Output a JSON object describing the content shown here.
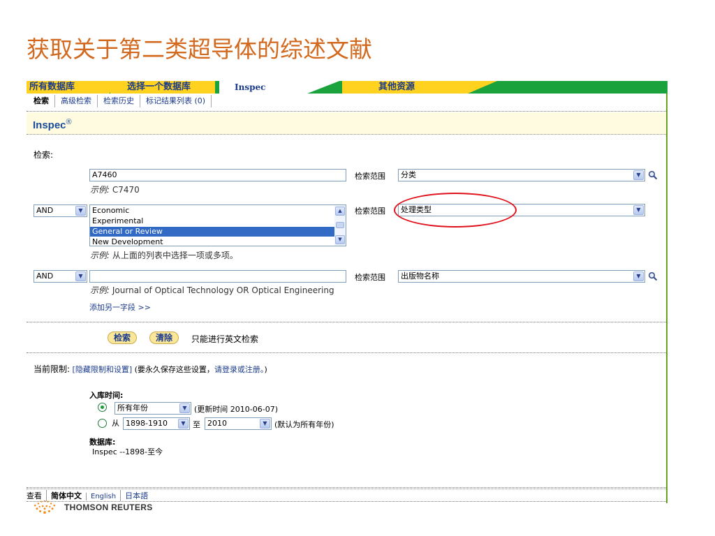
{
  "slide": {
    "title": "获取关于第二类超导体的综述文献"
  },
  "tabs": {
    "all": "所有数据库",
    "choose": "选择一个数据库",
    "current": "Inspec",
    "other": "其他资源"
  },
  "subnav": {
    "search": "检索",
    "advanced": "高级检索",
    "history": "检索历史",
    "marked": "标记结果列表 (0)"
  },
  "db": {
    "name": "Inspec",
    "reg": "®"
  },
  "form": {
    "search_label": "检索:",
    "row1": {
      "value": "A7460",
      "hint_prefix": "示例:",
      "hint": "C7470",
      "scope_label": "检索范围",
      "scope_value": "分类"
    },
    "row2": {
      "operator": "AND",
      "options": [
        "Economic",
        "Experimental",
        "General or Review",
        "New Development"
      ],
      "selected": "General or Review",
      "hint_prefix": "示例:",
      "hint": "从上面的列表中选择一项或多项。",
      "scope_label": "检索范围",
      "scope_value": "处理类型"
    },
    "row3": {
      "operator": "AND",
      "value": "",
      "hint_prefix": "示例:",
      "hint": "Journal of Optical Technology OR Optical Engineering",
      "scope_label": "检索范围",
      "scope_value": "出版物名称"
    },
    "add_field": "添加另一字段 >>",
    "search_btn": "检索",
    "clear_btn": "清除",
    "english_only": "只能进行英文检索"
  },
  "limits": {
    "label": "当前限制:",
    "hide_link": "[隐藏限制和设置]",
    "save_note_pre": "(要永久保存这些设置，",
    "save_link": "请登录或注册。",
    "save_note_post": ")",
    "timespan_label": "入库时间:",
    "all_years": "所有年份",
    "updated": "(更新时间 2010-06-07)",
    "from_label": "从",
    "from_value": "1898-1910",
    "to_label": "至",
    "to_value": "2010",
    "default_note": "(默认为所有年份)",
    "database_label": "数据库:",
    "database_value": "Inspec --1898-至今"
  },
  "footer": {
    "view": "查看",
    "zh": "简体中文",
    "en": "English",
    "ja": "日本語",
    "brand": "THOMSON REUTERS"
  },
  "colors": {
    "accent_green": "#1aa33c",
    "tab_yellow": "#ffd21f",
    "highlight_red": "#e0101a",
    "title_orange": "#d2691e"
  }
}
